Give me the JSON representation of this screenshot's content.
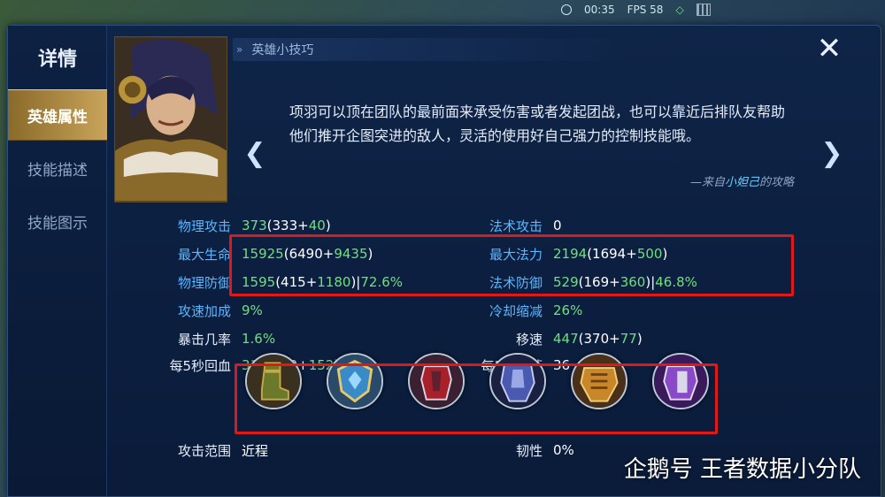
{
  "status": {
    "time": "00:35",
    "fps": "FPS 58"
  },
  "sidebar": {
    "title": "详情",
    "items": [
      {
        "label": "英雄属性"
      },
      {
        "label": "技能描述"
      },
      {
        "label": "技能图示"
      }
    ]
  },
  "tips": {
    "header": "英雄小技巧",
    "text": "项羽可以顶在团队的最前面来承受伤害或者发起团战，也可以靠近后排队友帮助他们推开企图突进的敌人，灵活的使用好自己强力的控制技能哦。",
    "source_prefix": "—来自",
    "source_author": "小妲己",
    "source_suffix": "的攻略"
  },
  "stats": {
    "physical_attack": {
      "label": "物理攻击",
      "total": "373",
      "base": "333",
      "bonus": "40"
    },
    "magic_attack": {
      "label": "法术攻击",
      "total": "0"
    },
    "max_hp": {
      "label": "最大生命",
      "total": "15925",
      "base": "6490",
      "bonus": "9435"
    },
    "max_mana": {
      "label": "最大法力",
      "total": "2194",
      "base": "1694",
      "bonus": "500"
    },
    "physical_defense": {
      "label": "物理防御",
      "total": "1595",
      "base": "415",
      "bonus": "1180",
      "percent": "72.6%"
    },
    "magic_defense": {
      "label": "法术防御",
      "total": "529",
      "base": "169",
      "bonus": "360",
      "percent": "46.8%"
    },
    "attack_speed": {
      "label": "攻速加成",
      "value": "9%"
    },
    "cooldown": {
      "label": "冷却缩减",
      "value": "26%"
    },
    "crit_rate": {
      "label": "暴击几率",
      "value": "1.6%"
    },
    "move_speed": {
      "label": "移速",
      "total": "447",
      "base": "370",
      "bonus": "77"
    },
    "hp_regen": {
      "label": "每5秒回血",
      "total": "312",
      "base": "160",
      "bonus": "152"
    },
    "mana_regen": {
      "label": "每5秒回蓝",
      "value": "36"
    },
    "attack_range": {
      "label": "攻击范围",
      "value": "近程"
    },
    "tenacity": {
      "label": "韧性",
      "value": "0%"
    }
  },
  "equipment": [
    {
      "name": "boots-icon"
    },
    {
      "name": "shield-icon"
    },
    {
      "name": "armor-red-icon"
    },
    {
      "name": "armor-blue-icon"
    },
    {
      "name": "golden-armor-icon"
    },
    {
      "name": "purple-armor-icon"
    }
  ],
  "watermark": "企鹅号 王者数据小分队",
  "colors": {
    "highlight": "#e01818",
    "bonus_green": "#6fe07a",
    "label_blue": "#5ab6ff",
    "active_tab": "#c9a45a"
  }
}
